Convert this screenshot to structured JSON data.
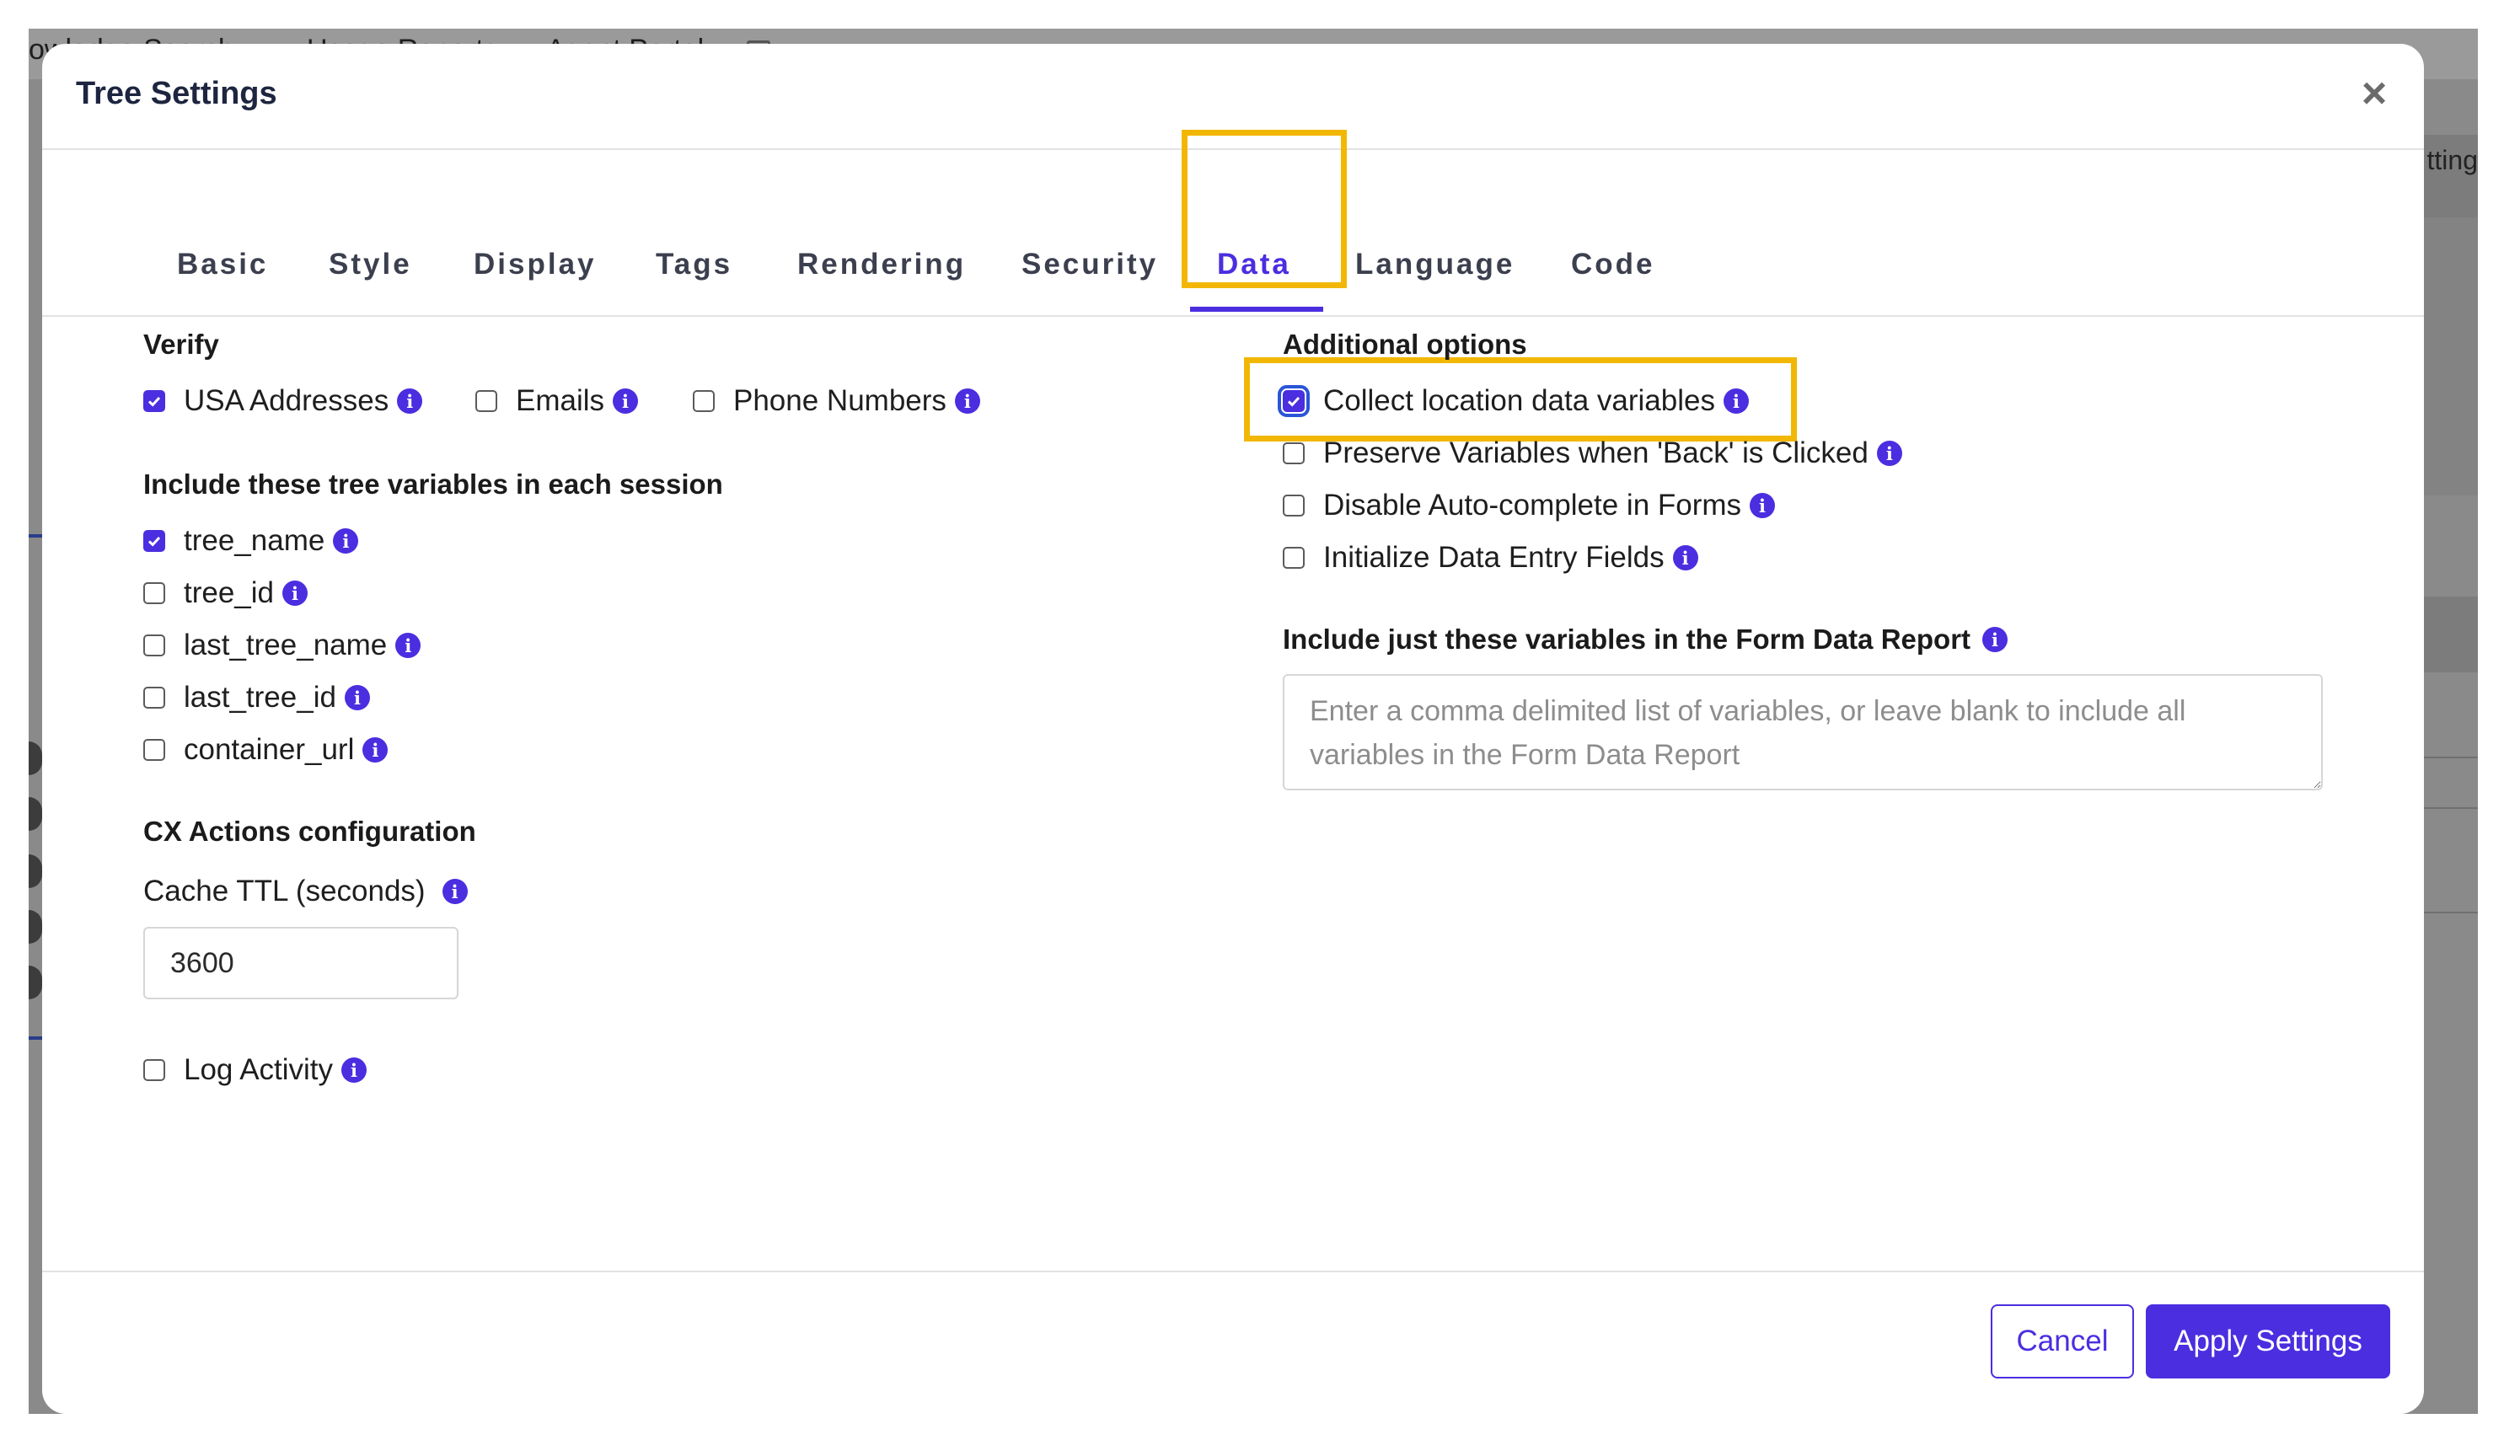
{
  "background": {
    "nav_items": [
      "owledge Search",
      "Usage Reports",
      "Agent Portal"
    ],
    "right_text": "tting"
  },
  "modal": {
    "title": "Tree Settings",
    "close_label": "×",
    "tabs": [
      {
        "label": "Basic",
        "active": false
      },
      {
        "label": "Style",
        "active": false
      },
      {
        "label": "Display",
        "active": false
      },
      {
        "label": "Tags",
        "active": false
      },
      {
        "label": "Rendering",
        "active": false
      },
      {
        "label": "Security",
        "active": false
      },
      {
        "label": "Data",
        "active": true
      },
      {
        "label": "Language",
        "active": false
      },
      {
        "label": "Code",
        "active": false
      }
    ],
    "verify": {
      "title": "Verify",
      "options": [
        {
          "label": "USA Addresses",
          "checked": true
        },
        {
          "label": "Emails",
          "checked": false
        },
        {
          "label": "Phone Numbers",
          "checked": false
        }
      ]
    },
    "tree_vars": {
      "title": "Include these tree variables in each session",
      "options": [
        {
          "label": "tree_name",
          "checked": true
        },
        {
          "label": "tree_id",
          "checked": false
        },
        {
          "label": "last_tree_name",
          "checked": false
        },
        {
          "label": "last_tree_id",
          "checked": false
        },
        {
          "label": "container_url",
          "checked": false
        }
      ]
    },
    "cx": {
      "title": "CX Actions configuration",
      "cache_label": "Cache TTL (seconds)",
      "cache_value": "3600",
      "log_label": "Log Activity",
      "log_checked": false
    },
    "additional": {
      "title": "Additional options",
      "options": [
        {
          "label": "Collect location data variables",
          "checked": true
        },
        {
          "label": "Preserve Variables when 'Back' is Clicked",
          "checked": false
        },
        {
          "label": "Disable Auto-complete in Forms",
          "checked": false
        },
        {
          "label": "Initialize Data Entry Fields",
          "checked": false
        }
      ]
    },
    "form_report": {
      "title": "Include just these variables in the Form Data Report",
      "placeholder": "Enter a comma delimited list of variables, or leave blank to include all variables in the Form Data Report",
      "value": ""
    },
    "buttons": {
      "cancel": "Cancel",
      "apply": "Apply Settings"
    },
    "info_glyph": "i"
  },
  "colors": {
    "accent": "#4a2ee0",
    "highlight": "#f2b705",
    "title": "#1d2540"
  }
}
